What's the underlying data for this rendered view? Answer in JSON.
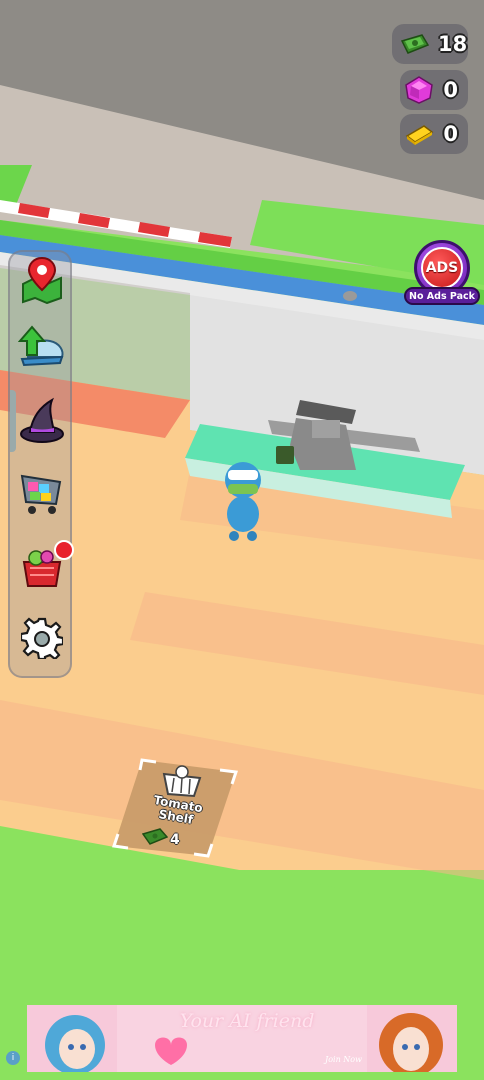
{
  "hud": {
    "cash": {
      "icon": "cash-icon",
      "amount": "18"
    },
    "gems": {
      "icon": "gem-icon",
      "amount": "0"
    },
    "gold": {
      "icon": "gold-bar-icon",
      "amount": "0"
    }
  },
  "menu": {
    "items": [
      {
        "name": "map",
        "icon": "map-pin-icon"
      },
      {
        "name": "upgrades",
        "icon": "cap-upgrade-icon"
      },
      {
        "name": "witch-hat",
        "icon": "witch-hat-icon"
      },
      {
        "name": "shopping-cart",
        "icon": "shopping-cart-icon"
      },
      {
        "name": "basket",
        "icon": "basket-icon",
        "notification": true
      },
      {
        "name": "settings",
        "icon": "gear-icon"
      }
    ]
  },
  "ads_pack": {
    "badge": "ADS",
    "label": "No Ads Pack"
  },
  "shelf": {
    "name": "Tomato Shelf",
    "price": "4",
    "icon": "basket-icon"
  },
  "banner": {
    "title": "Your AI friend",
    "cta": "Join Now"
  },
  "colors": {
    "floor": "#fbcd8e",
    "grass": "#8be25e",
    "counter": "#5fe3b1",
    "wall": "#e8e8e8",
    "road": "#c6bfb6",
    "stripe_blue": "#4a90d9",
    "notification": "#e8212d"
  }
}
